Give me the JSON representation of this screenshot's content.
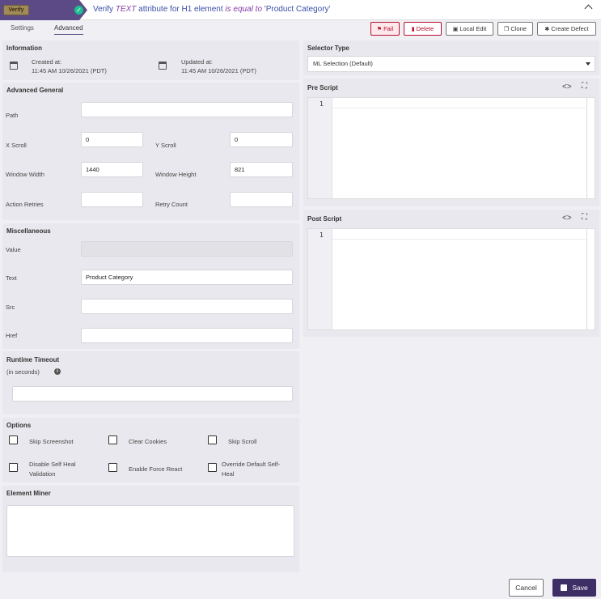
{
  "header": {
    "logo_text": "Verify",
    "title_prefix": "Verify ",
    "title_attr": "TEXT",
    "title_mid": " attribute for H1  element ",
    "title_cond": "is equal to",
    "title_suffix": " 'Product Category'"
  },
  "tabs": [
    {
      "label": "Settings"
    },
    {
      "label": "Advanced"
    }
  ],
  "toolbar": {
    "fail_label": "Fail",
    "delete_label": "Delete",
    "local_edit_label": "Local Edit",
    "clone_label": "Clone",
    "create_defect_label": "Create Defect"
  },
  "information": {
    "title": "Information",
    "created_label": "Created at:",
    "created_value": "11:45 AM 10/26/2021 (PDT)",
    "updated_label": "Updated at:",
    "updated_value": "11:45 AM 10/26/2021 (PDT)"
  },
  "advanced_general": {
    "title": "Advanced General",
    "path_label": "Path",
    "path_value": "",
    "x_scroll_label": "X Scroll",
    "x_scroll_value": "0",
    "y_scroll_label": "Y Scroll",
    "y_scroll_value": "0",
    "window_width_label": "Window Width",
    "window_width_value": "1440",
    "window_height_label": "Window Height",
    "window_height_value": "821",
    "action_retries_label": "Action Retries",
    "action_retries_value": "",
    "retry_count_label": "Retry Count",
    "retry_count_value": ""
  },
  "miscellaneous": {
    "title": "Miscellaneous",
    "value_label": "Value",
    "value_value": "",
    "text_label": "Text",
    "text_value": "Product Category",
    "src_label": "Src",
    "src_value": "",
    "href_label": "Href",
    "href_value": ""
  },
  "runtime_timeout": {
    "title": "Runtime Timeout",
    "subtitle": "(in seconds)",
    "value": ""
  },
  "options": {
    "title": "Options",
    "skip_screenshot": "Skip Screenshot",
    "clear_cookies": "Clear Cookies",
    "skip_scroll": "Skip Scroll",
    "disable_self_heal_1": "Disable Self Heal",
    "disable_self_heal_2": "Validation",
    "enable_force_react": "Enable Force React",
    "override_self_heal_1": "Override Default Self-",
    "override_self_heal_2": "Heal"
  },
  "element_miner": {
    "title": "Element Miner"
  },
  "selector_type": {
    "title": "Selector Type",
    "selected": "ML Selection (Default)"
  },
  "pre_script": {
    "title": "Pre Script",
    "line": "1"
  },
  "post_script": {
    "title": "Post Script",
    "line": "1"
  },
  "footer": {
    "cancel_label": "Cancel",
    "save_label": "Save"
  },
  "colors": {
    "brand": "#5b4a86",
    "danger": "#b8102e",
    "primary_button": "#3d2e66",
    "success": "#1fbf8f"
  }
}
